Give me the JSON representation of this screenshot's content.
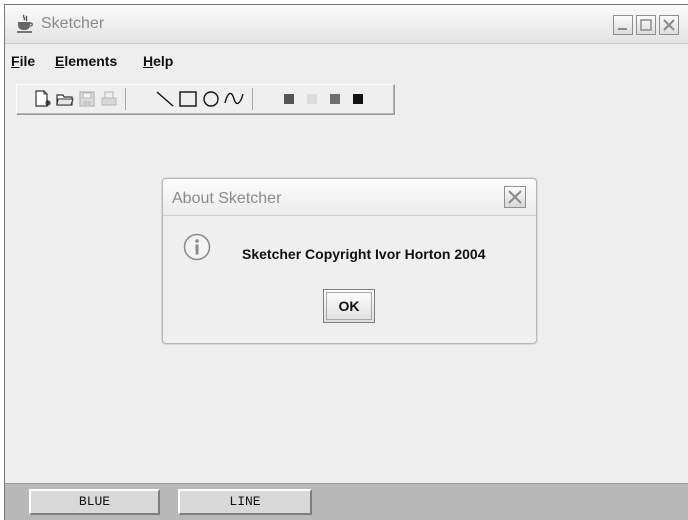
{
  "window": {
    "title": "Sketcher",
    "app_icon": "java-cup-icon",
    "controls": [
      "minimize-icon",
      "maximize-icon",
      "close-icon"
    ]
  },
  "menubar": {
    "items": [
      {
        "label": "File",
        "mnemonic": "F",
        "rest": "ile"
      },
      {
        "label": "Elements",
        "mnemonic": "E",
        "rest": "lements"
      },
      {
        "label": "Help",
        "mnemonic": "H",
        "rest": "elp"
      }
    ]
  },
  "toolbar": {
    "file_buttons": [
      {
        "icon": "new-file-icon",
        "enabled": true
      },
      {
        "icon": "open-file-icon",
        "enabled": true
      },
      {
        "icon": "save-icon",
        "enabled": false
      },
      {
        "icon": "print-icon",
        "enabled": false
      }
    ],
    "element_buttons": [
      {
        "icon": "line-tool-icon"
      },
      {
        "icon": "rectangle-tool-icon"
      },
      {
        "icon": "circle-tool-icon"
      },
      {
        "icon": "curve-tool-icon"
      }
    ],
    "color_buttons": [
      {
        "icon": "color-red-swatch-icon",
        "color": "#555555"
      },
      {
        "icon": "color-yellow-swatch-icon",
        "color": "#dcdcdc"
      },
      {
        "icon": "color-green-swatch-icon",
        "color": "#6f6f6f"
      },
      {
        "icon": "color-blue-swatch-icon",
        "color": "#111111"
      }
    ]
  },
  "dialog": {
    "title": "About Sketcher",
    "message": "Sketcher Copyright Ivor Horton 2004",
    "icon": "info-icon",
    "ok_label": "OK"
  },
  "status": {
    "color": "BLUE",
    "element_type": "LINE"
  }
}
